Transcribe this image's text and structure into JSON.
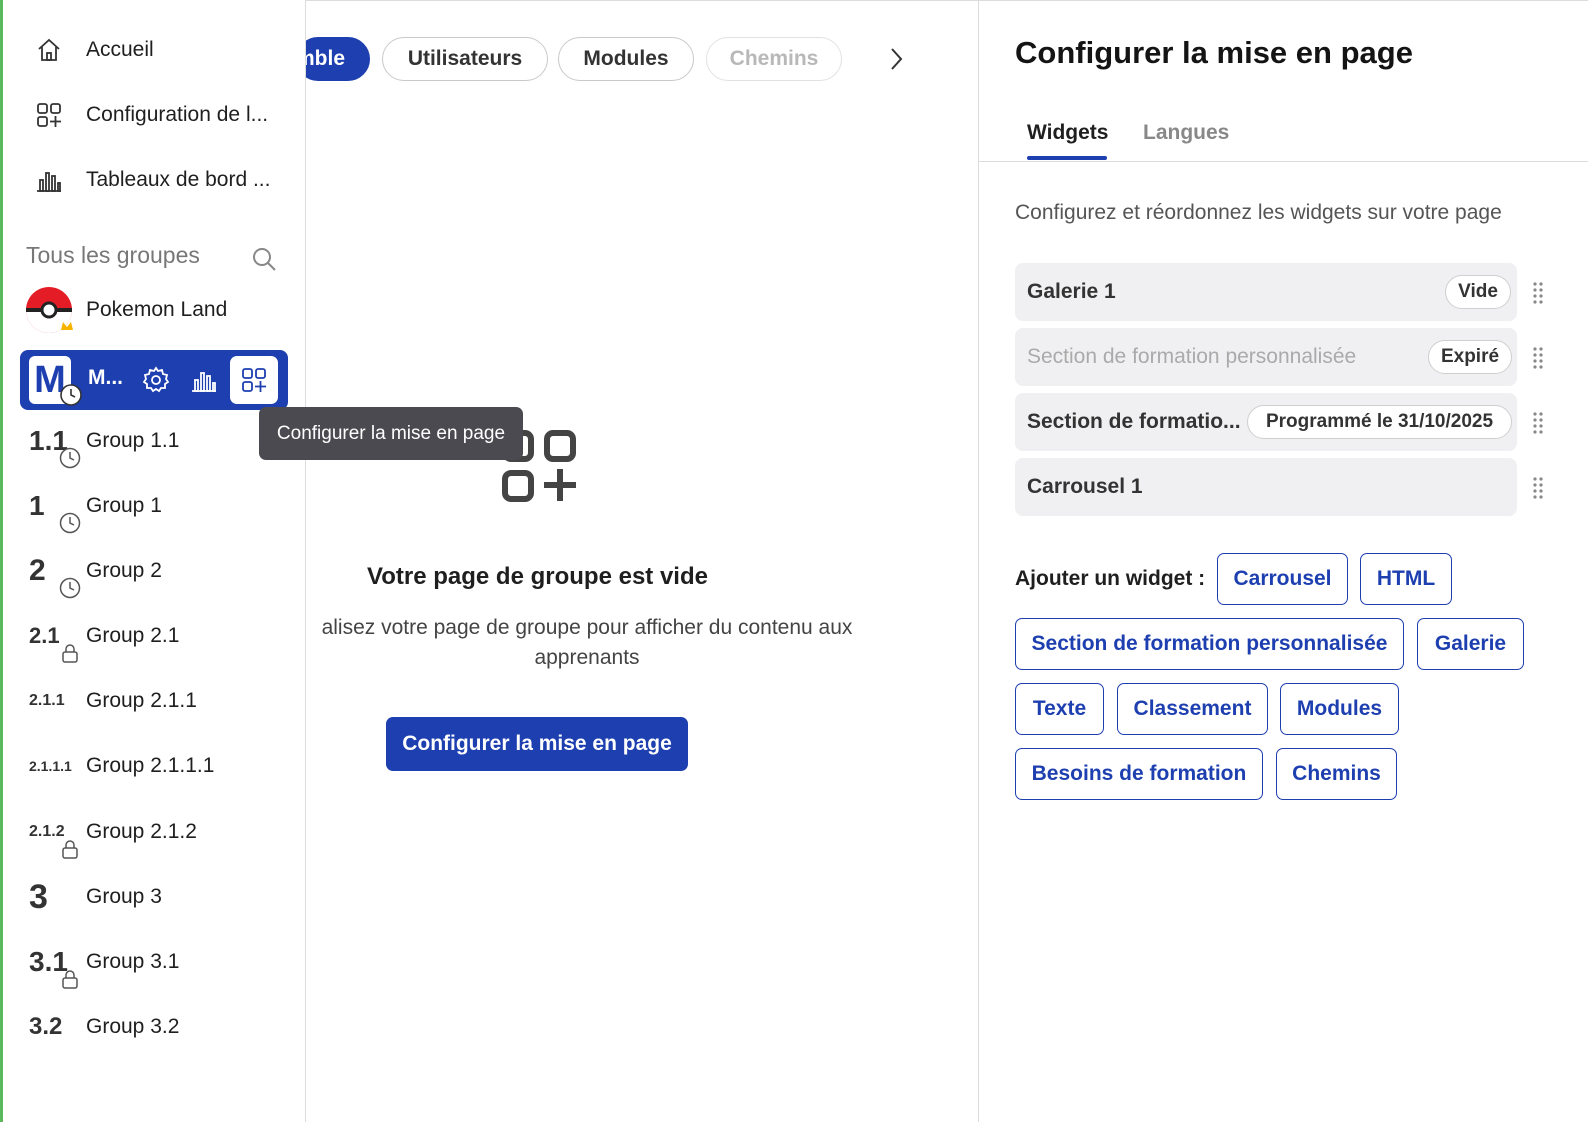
{
  "sidebar": {
    "nav": [
      {
        "label": "Accueil",
        "icon": "home-icon"
      },
      {
        "label": "Configuration de l...",
        "icon": "layout-grid-icon"
      },
      {
        "label": "Tableaux de bord ...",
        "icon": "bar-chart-icon"
      }
    ],
    "groups_header": "Tous les groupes",
    "pokemon": {
      "label": "Pokemon Land"
    },
    "active_group": {
      "avatar": "M",
      "name": "M..."
    },
    "groups": [
      {
        "badge": "1.1",
        "label": "Group 1.1",
        "status": "clock"
      },
      {
        "badge": "1",
        "label": "Group 1",
        "status": "clock"
      },
      {
        "badge": "2",
        "label": "Group 2",
        "status": "clock"
      },
      {
        "badge": "2.1",
        "label": "Group 2.1",
        "status": "lock"
      },
      {
        "badge": "2.1.1",
        "label": "Group 2.1.1",
        "status": ""
      },
      {
        "badge": "2.1.1.1",
        "label": "Group 2.1.1.1",
        "status": ""
      },
      {
        "badge": "2.1.2",
        "label": "Group 2.1.2",
        "status": "lock"
      },
      {
        "badge": "3",
        "label": "Group 3",
        "status": ""
      },
      {
        "badge": "3.1",
        "label": "Group 3.1",
        "status": "lock"
      },
      {
        "badge": "3.2",
        "label": "Group 3.2",
        "status": ""
      }
    ]
  },
  "tooltip": "Configurer la mise en page",
  "center": {
    "pills": [
      "mble",
      "Utilisateurs",
      "Modules",
      "Chemins"
    ],
    "empty_title": "Votre page de groupe est vide",
    "empty_desc_line1": "alisez votre page de groupe pour afficher du contenu aux",
    "empty_desc_line2": "apprenants",
    "button": "Configurer la mise en page"
  },
  "panel": {
    "title": "Configurer la mise en page",
    "tabs": [
      "Widgets",
      "Langues"
    ],
    "description": "Configurez et réordonnez les widgets sur votre page",
    "widgets": [
      {
        "name": "Galerie 1",
        "badge": "Vide"
      },
      {
        "name": "Section de formation personnalisée",
        "badge": "Expiré"
      },
      {
        "name": "Section de formatio...",
        "badge": "Programmé le 31/10/2025"
      },
      {
        "name": "Carrousel 1",
        "badge": ""
      }
    ],
    "add_label": "Ajouter un widget :",
    "chips": [
      "Carrousel",
      "HTML",
      "Section de formation personnalisée",
      "Galerie",
      "Texte",
      "Classement",
      "Modules",
      "Besoins de formation",
      "Chemins"
    ]
  },
  "colors": {
    "brand": "#1d3fb0",
    "accent_line": "#5cb85c",
    "tooltip_bg": "#4a4a50"
  }
}
